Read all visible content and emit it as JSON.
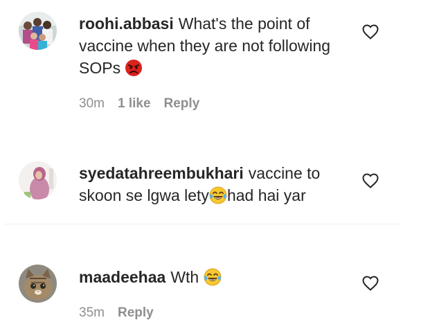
{
  "comments": [
    {
      "username": "roohi.abbasi",
      "text_parts": [
        "What's the point of vaccine when they are not following SOPs",
        ""
      ],
      "emoji": "angry-face-emoji",
      "time": "30m",
      "likes": "1 like",
      "reply": "Reply",
      "avatar": "family-group-photo"
    },
    {
      "username": "syedatahreembukhari",
      "text_parts": [
        "vaccine to skoon se lgwa lety",
        "had hai yar"
      ],
      "emoji": "tears-of-joy-emoji",
      "avatar": "girl-in-pink-hijab"
    },
    {
      "username": "maadeehaa",
      "text_parts": [
        "Wth",
        ""
      ],
      "emoji": "tears-of-joy-emoji",
      "time": "35m",
      "reply": "Reply",
      "avatar": "tabby-cat-photo"
    }
  ],
  "colors": {
    "text": "#262626",
    "meta": "#8e8e8e",
    "divider": "#efefef"
  },
  "icons": {
    "like": "heart-outline-icon"
  }
}
